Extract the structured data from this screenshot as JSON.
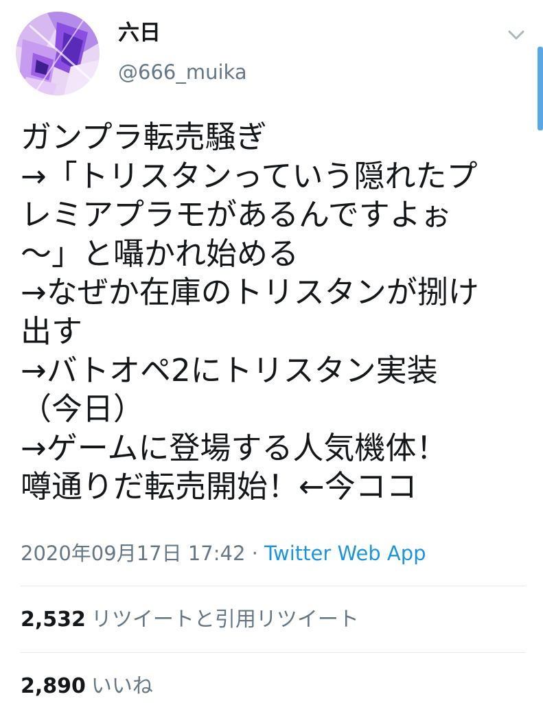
{
  "user": {
    "display_name": "六日",
    "handle": "@666_muika",
    "avatar_icon": "avatar-image",
    "menu_icon": "chevron-down-icon"
  },
  "tweet": {
    "lines": [
      "ガンプラ転売騒ぎ",
      "→「トリスタンっていう隠れたプ",
      "レミアプラモがあるんですよぉ",
      "〜」と囁かれ始める",
      "→なぜか在庫のトリスタンが捌け",
      "出す",
      "→バトオペ2にトリスタン実装",
      "（今日）",
      "→ゲームに登場する人気機体！",
      "噂通りだ転売開始！←今ココ"
    ]
  },
  "meta": {
    "timestamp": "2020年09月17日 17:42",
    "separator": " · ",
    "source": "Twitter Web App"
  },
  "stats": {
    "retweets_count": "2,532",
    "retweets_label": "リツイートと引用リツイート",
    "likes_count": "2,890",
    "likes_label": "いいね"
  },
  "colors": {
    "text": "#14171a",
    "secondary": "#657786",
    "link": "#1b95e0",
    "divider": "#e1e8ed",
    "scrollbar": "#5aa7e6"
  }
}
